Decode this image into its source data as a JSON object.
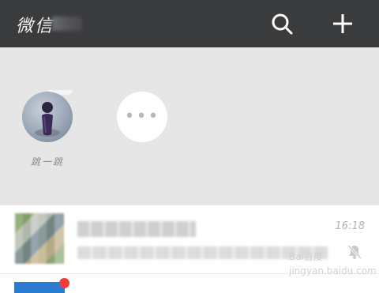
{
  "header": {
    "title": "微信",
    "icons": {
      "search": "search-icon",
      "add": "plus-icon"
    }
  },
  "mini_programs": [
    {
      "label": "跳一跳",
      "icon": "jump-game-icon"
    },
    {
      "label": "",
      "icon": "more-dots-icon"
    }
  ],
  "chats": [
    {
      "name": "",
      "preview": "",
      "time": "16:18",
      "muted": true
    }
  ],
  "watermark": {
    "line1": "Bai百度",
    "line2": "jingyan.baidu.com"
  },
  "colors": {
    "header_bg": "#3a3b3d",
    "panel_bg": "#e6e6e6",
    "unread": "#f23b3b"
  }
}
